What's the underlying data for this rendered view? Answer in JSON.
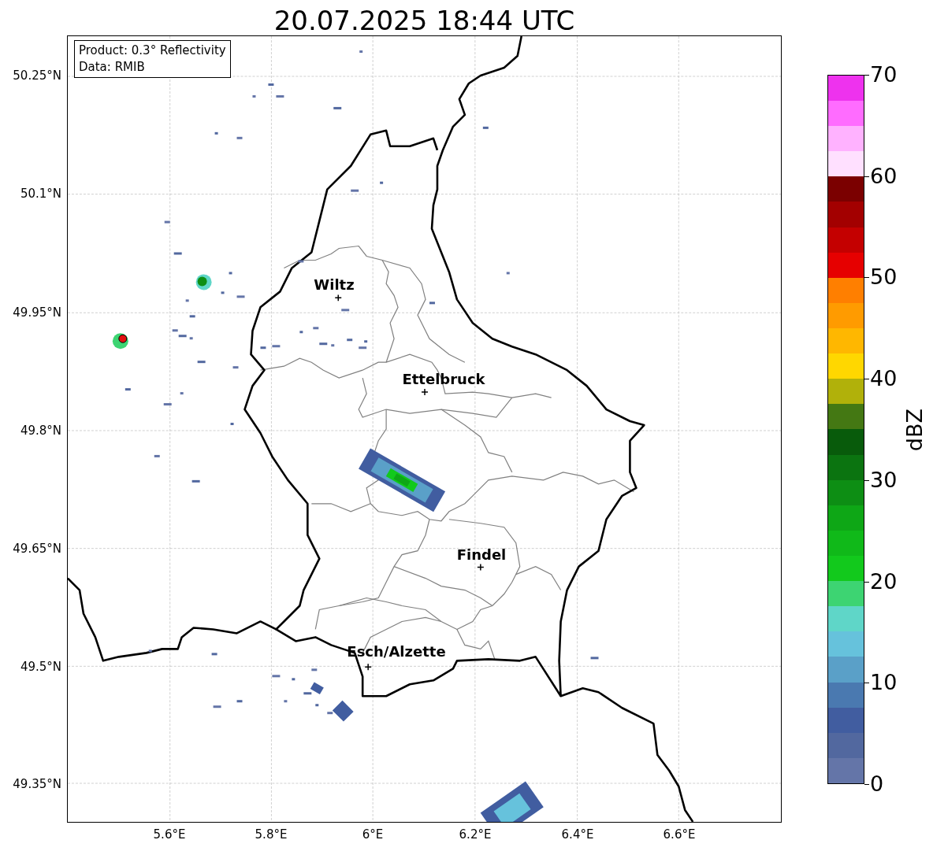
{
  "title": "20.07.2025 18:44 UTC",
  "info_box": [
    "Product: 0.3° Reflectivity",
    "Data: RMIB"
  ],
  "y_axis_labels": [
    "50.25°N",
    "50.1°N",
    "49.95°N",
    "49.8°N",
    "49.65°N",
    "49.5°N",
    "49.35°N"
  ],
  "x_axis_labels": [
    "5.6°E",
    "5.8°E",
    "6°E",
    "6.2°E",
    "6.4°E",
    "6.6°E"
  ],
  "cities": [
    {
      "name": "Wiltz"
    },
    {
      "name": "Ettelbruck"
    },
    {
      "name": "Findel"
    },
    {
      "name": "Esch/Alzette"
    }
  ],
  "colorbar": {
    "label": "dBZ",
    "ticks": [
      "70",
      "60",
      "50",
      "40",
      "30",
      "20",
      "10",
      "0"
    ],
    "bins": [
      {
        "color": "#6475a8"
      },
      {
        "color": "#52689f"
      },
      {
        "color": "#415da0"
      },
      {
        "color": "#4a79b0"
      },
      {
        "color": "#5aa0c8"
      },
      {
        "color": "#66c2dc"
      },
      {
        "color": "#5fd6c8"
      },
      {
        "color": "#3dd472"
      },
      {
        "color": "#12c91c"
      },
      {
        "color": "#10b919"
      },
      {
        "color": "#0ea716"
      },
      {
        "color": "#0d8e14"
      },
      {
        "color": "#0b7410"
      },
      {
        "color": "#085b0b"
      },
      {
        "color": "#447813"
      },
      {
        "color": "#b1b10a"
      },
      {
        "color": "#ffd700"
      },
      {
        "color": "#ffb700"
      },
      {
        "color": "#ff9b00"
      },
      {
        "color": "#ff7f00"
      },
      {
        "color": "#e60000"
      },
      {
        "color": "#c40000"
      },
      {
        "color": "#a30000"
      },
      {
        "color": "#7b0000"
      },
      {
        "color": "#ffe0ff"
      },
      {
        "color": "#ffb2ff"
      },
      {
        "color": "#ff6cff"
      },
      {
        "color": "#ee32ee"
      }
    ]
  }
}
